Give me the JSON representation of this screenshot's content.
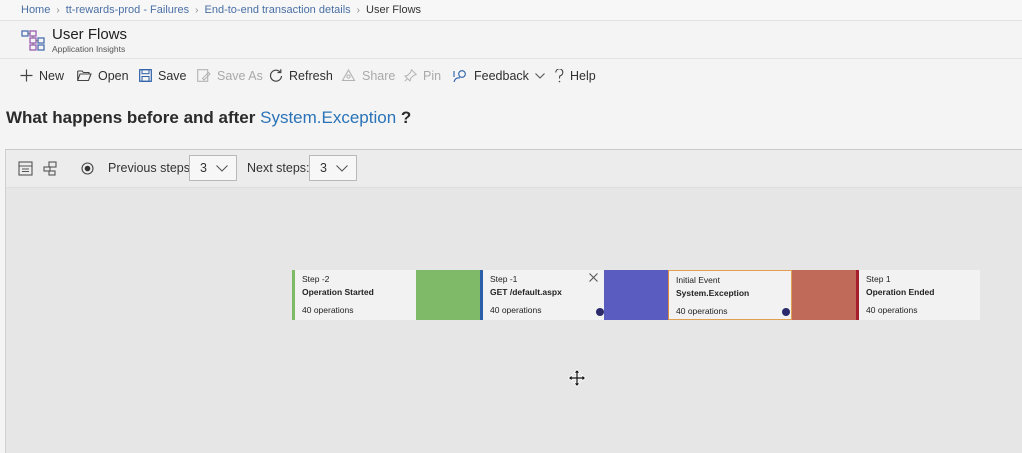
{
  "breadcrumb": {
    "items": [
      "Home",
      "tt-rewards-prod - Failures",
      "End-to-end transaction details"
    ],
    "current": "User Flows"
  },
  "header": {
    "title": "User Flows",
    "subtitle": "Application Insights",
    "icon": "user-flows-icon"
  },
  "toolbar": {
    "new": "New",
    "open": "Open",
    "save": "Save",
    "save_as": "Save As",
    "refresh": "Refresh",
    "share": "Share",
    "pin": "Pin",
    "feedback": "Feedback",
    "help": "Help"
  },
  "question": {
    "prefix": "What happens before and after",
    "event": "System.Exception",
    "suffix": "?"
  },
  "controls": {
    "previous_label": "Previous steps:",
    "previous_value": "3",
    "next_label": "Next steps:",
    "next_value": "3"
  },
  "flow": {
    "colors": {
      "green": "#7fba69",
      "blue": "#2b5faa",
      "purple": "#5b5cc0",
      "orange": "#e08a3c",
      "red": "#c06a5a",
      "darkred": "#a61e2b"
    },
    "nodes": [
      {
        "step": "Step -2",
        "name": "Operation Started",
        "count": "40 operations"
      },
      {
        "step": "Step -1",
        "name": "GET /default.aspx",
        "count": "40 operations"
      },
      {
        "step": "Initial Event",
        "name": "System.Exception",
        "count": "40 operations"
      },
      {
        "step": "Step 1",
        "name": "Operation Ended",
        "count": "40 operations"
      }
    ]
  }
}
